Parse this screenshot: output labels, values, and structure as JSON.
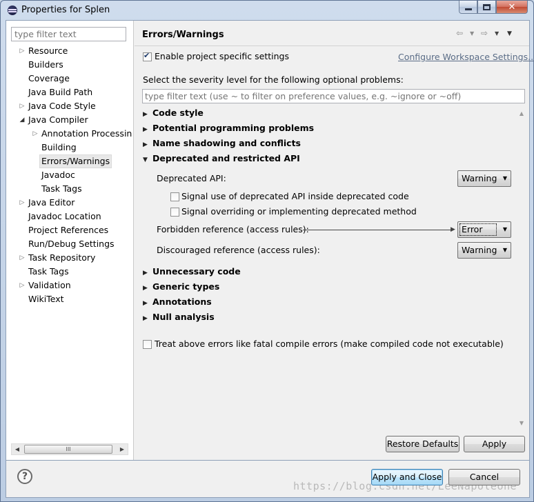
{
  "window": {
    "title": "Properties for Splen"
  },
  "left": {
    "filter_placeholder": "type filter text",
    "tree": [
      {
        "label": "Resource",
        "expandable": true,
        "level": 0
      },
      {
        "label": "Builders",
        "expandable": false,
        "level": 0
      },
      {
        "label": "Coverage",
        "expandable": false,
        "level": 0
      },
      {
        "label": "Java Build Path",
        "expandable": false,
        "level": 0
      },
      {
        "label": "Java Code Style",
        "expandable": true,
        "level": 0
      },
      {
        "label": "Java Compiler",
        "expandable": true,
        "expanded": true,
        "level": 0
      },
      {
        "label": "Annotation Processin",
        "expandable": true,
        "level": 1
      },
      {
        "label": "Building",
        "expandable": false,
        "level": 1
      },
      {
        "label": "Errors/Warnings",
        "expandable": false,
        "level": 1,
        "selected": true
      },
      {
        "label": "Javadoc",
        "expandable": false,
        "level": 1
      },
      {
        "label": "Task Tags",
        "expandable": false,
        "level": 1
      },
      {
        "label": "Java Editor",
        "expandable": true,
        "level": 0
      },
      {
        "label": "Javadoc Location",
        "expandable": false,
        "level": 0
      },
      {
        "label": "Project References",
        "expandable": false,
        "level": 0
      },
      {
        "label": "Run/Debug Settings",
        "expandable": false,
        "level": 0
      },
      {
        "label": "Task Repository",
        "expandable": true,
        "level": 0
      },
      {
        "label": "Task Tags",
        "expandable": false,
        "level": 0
      },
      {
        "label": "Validation",
        "expandable": true,
        "level": 0
      },
      {
        "label": "WikiText",
        "expandable": false,
        "level": 0
      }
    ],
    "scroll_thumb": "III"
  },
  "right": {
    "title": "Errors/Warnings",
    "enable_label": "Enable project specific settings",
    "enable_checked": true,
    "configure_link": "Configure Workspace Settings...",
    "severity_label": "Select the severity level for the following optional problems:",
    "filter_placeholder": "type filter text (use ~ to filter on preference values, e.g. ~ignore or ~off)",
    "sections": {
      "code_style": "Code style",
      "potential": "Potential programming problems",
      "shadowing": "Name shadowing and conflicts",
      "deprecated": "Deprecated and restricted API",
      "unnecessary": "Unnecessary code",
      "generic": "Generic types",
      "annotations": "Annotations",
      "null": "Null analysis"
    },
    "deprecated_api_label": "Deprecated API:",
    "deprecated_api_value": "Warning",
    "signal_inside_label": "Signal use of deprecated API inside deprecated code",
    "signal_overriding_label": "Signal overriding or implementing deprecated method",
    "forbidden_label": "Forbidden reference (access rules):",
    "forbidden_value": "Error",
    "discouraged_label": "Discouraged reference (access rules):",
    "discouraged_value": "Warning",
    "treat_label": "Treat above errors like fatal compile errors (make compiled code not executable)",
    "restore_defaults": "Restore Defaults",
    "apply": "Apply"
  },
  "footer": {
    "apply_close": "Apply and Close",
    "cancel": "Cancel",
    "watermark": "https://blog.csdn.net/LeeNapoleone"
  }
}
